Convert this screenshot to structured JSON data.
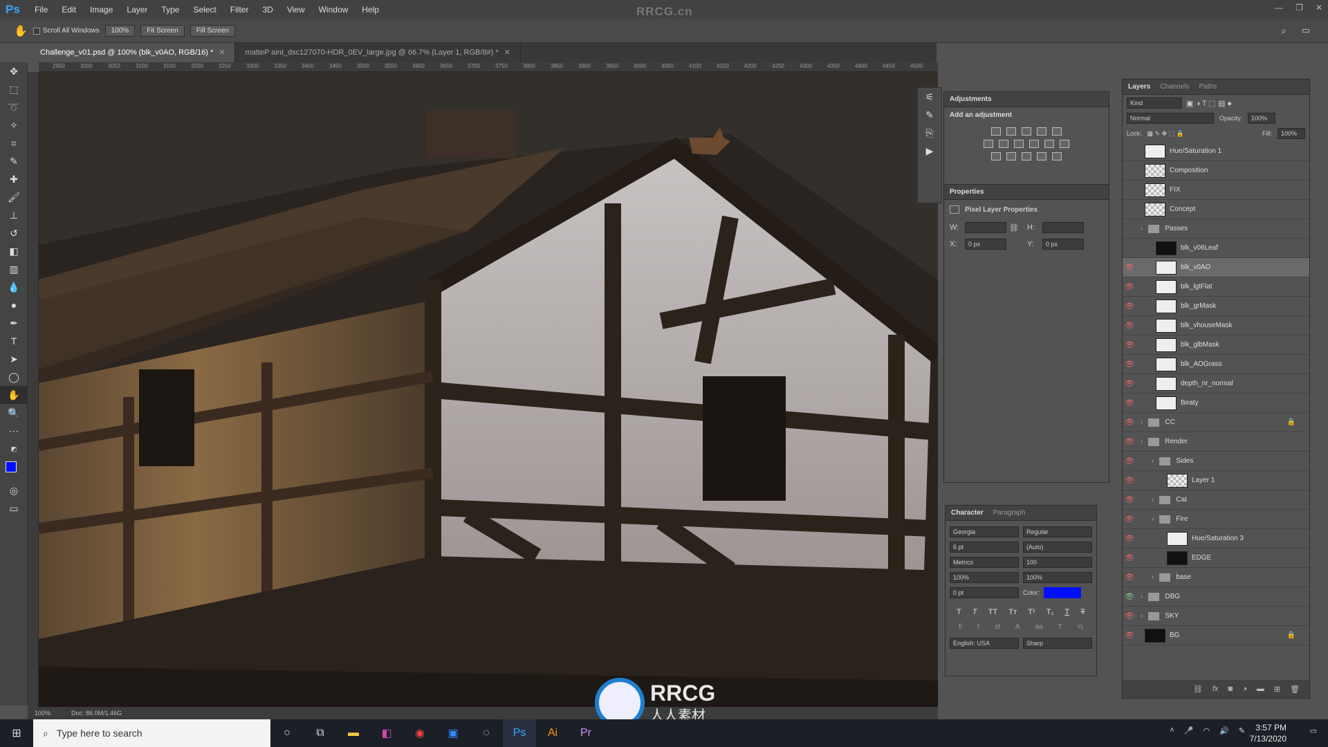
{
  "app_logo": "Ps",
  "watermark": "RRCG.cn",
  "menu": [
    "File",
    "Edit",
    "Image",
    "Layer",
    "Type",
    "Select",
    "Filter",
    "3D",
    "View",
    "Window",
    "Help"
  ],
  "options": {
    "scroll_all": "Scroll All Windows",
    "zoom": "100%",
    "fit": "Fit Screen",
    "fill": "Fill Screen"
  },
  "tabs": [
    {
      "label": "Challenge_v01.psd @ 100% (blk_v0AO, RGB/16) *"
    },
    {
      "label": "matteP aint_dsc127070-HDR_0EV_large.jpg @ 66.7% (Layer 1, RGB/8#) *"
    }
  ],
  "ruler_ticks": [
    "2950",
    "3000",
    "3050",
    "3100",
    "3150",
    "3200",
    "3250",
    "3300",
    "3350",
    "3400",
    "3450",
    "3500",
    "3550",
    "3600",
    "3650",
    "3700",
    "3750",
    "3800",
    "3850",
    "3900",
    "3950",
    "4000",
    "4050",
    "4100",
    "4150",
    "4200",
    "4250",
    "4300",
    "4350",
    "4400",
    "4450",
    "4500"
  ],
  "status": {
    "zoom": "100%",
    "doc": "Doc: 86.0M/1.46G"
  },
  "adjustments": {
    "title": "Adjustments",
    "subtitle": "Add an adjustment"
  },
  "properties": {
    "title": "Properties",
    "heading": "Pixel Layer Properties",
    "w_label": "W:",
    "h_label": "H:",
    "x_label": "X:",
    "x_value": "0 px",
    "y_label": "Y:",
    "y_value": "0 px"
  },
  "character": {
    "tab1": "Character",
    "tab2": "Paragraph",
    "font": "Georgia",
    "style": "Regular",
    "size": "6 pt",
    "leading": "(Auto)",
    "kerning": "Metrics",
    "tracking": "100",
    "vscale": "100%",
    "hscale": "100%",
    "baseline": "0 pt",
    "color_label": "Color:",
    "color": "#0010ff",
    "language": "English: USA",
    "aa": "Sharp"
  },
  "layers_panel": {
    "tabs": [
      "Layers",
      "Channels",
      "Paths"
    ],
    "kind": "Kind",
    "blend": "Normal",
    "opacity_label": "Opacity:",
    "opacity": "100%",
    "lock_label": "Lock:",
    "fill_label": "Fill:",
    "fill": "100%",
    "rows": [
      {
        "name": "Hue/Saturation 1",
        "eye": "off",
        "thumb": "white",
        "indent": 0
      },
      {
        "name": "Composition",
        "eye": "off",
        "thumb": "chk",
        "indent": 0
      },
      {
        "name": "FIX",
        "eye": "off",
        "thumb": "chk",
        "indent": 0
      },
      {
        "name": "Concept",
        "eye": "off",
        "thumb": "chk",
        "indent": 0
      },
      {
        "name": "Passes",
        "eye": "off",
        "folder": true,
        "indent": 0
      },
      {
        "name": "blk_v06Leaf",
        "eye": "off",
        "thumb": "dark",
        "indent": 1
      },
      {
        "name": "blk_v0AO",
        "eye": "on",
        "thumb": "white",
        "indent": 1,
        "selected": true
      },
      {
        "name": "blk_lgtFlat",
        "eye": "on",
        "thumb": "white",
        "indent": 1
      },
      {
        "name": "blk_grMask",
        "eye": "on",
        "thumb": "white",
        "indent": 1
      },
      {
        "name": "blk_vhouseMask",
        "eye": "on",
        "thumb": "white",
        "indent": 1
      },
      {
        "name": "blk_glbMask",
        "eye": "on",
        "thumb": "white",
        "indent": 1
      },
      {
        "name": "blk_AOGrass",
        "eye": "on",
        "thumb": "white",
        "indent": 1
      },
      {
        "name": "depth_nr_normal",
        "eye": "on",
        "thumb": "white",
        "indent": 1
      },
      {
        "name": "Beaty",
        "eye": "on",
        "thumb": "white",
        "indent": 1
      },
      {
        "name": "CC",
        "eye": "on",
        "folder": true,
        "indent": 0,
        "lock": true
      },
      {
        "name": "Render",
        "eye": "on",
        "folder": true,
        "indent": 0
      },
      {
        "name": "Sides",
        "eye": "on",
        "folder": true,
        "indent": 1
      },
      {
        "name": "Layer 1",
        "eye": "on",
        "thumb": "chk",
        "indent": 2
      },
      {
        "name": "Cat",
        "eye": "on",
        "folder": true,
        "indent": 1
      },
      {
        "name": "Fire",
        "eye": "on",
        "folder": true,
        "indent": 1
      },
      {
        "name": "Hue/Saturation 3",
        "eye": "on",
        "thumb": "white",
        "indent": 2
      },
      {
        "name": "EDGE",
        "eye": "on",
        "thumb": "dark",
        "indent": 2
      },
      {
        "name": "base",
        "eye": "on",
        "folder": true,
        "indent": 1
      },
      {
        "name": "DBG",
        "eye": "green",
        "folder": true,
        "indent": 0
      },
      {
        "name": "SKY",
        "eye": "on",
        "folder": true,
        "indent": 0
      },
      {
        "name": "BG",
        "eye": "on",
        "thumb": "dark",
        "indent": 0,
        "lock": true
      }
    ]
  },
  "logo_overlay": {
    "brand": "RRCG",
    "sub": "人人素材"
  },
  "taskbar": {
    "search_placeholder": "Type here to search",
    "time": "3:57 PM",
    "date": "7/13/2020"
  }
}
